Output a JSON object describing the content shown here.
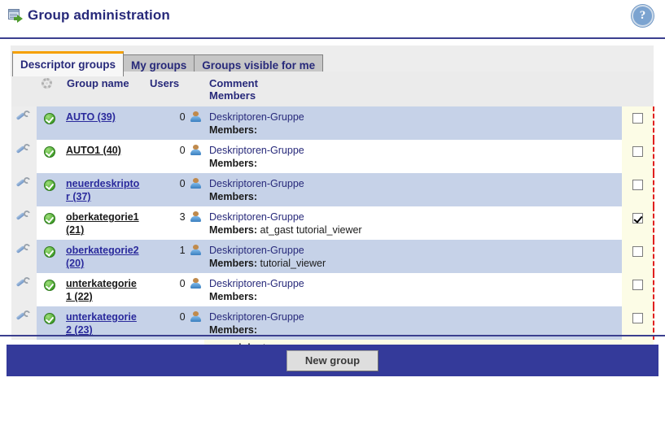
{
  "header": {
    "title": "Group administration",
    "title_icon": "window-export-icon",
    "help_icon": "help-question-icon",
    "help_glyph": "?"
  },
  "tabs": [
    {
      "label": "Descriptor groups",
      "active": true
    },
    {
      "label": "My groups",
      "active": false
    },
    {
      "label": "Groups visible for me",
      "active": false
    }
  ],
  "table": {
    "columns": {
      "wrench": "",
      "status": "",
      "status_icon": "gear-icon",
      "group_name": "Group name",
      "users": "Users",
      "comment": "Comment",
      "members": "Members",
      "check": ""
    },
    "rows": [
      {
        "wrench_icon": "wrench-icon",
        "status_icon": "green-check-icon",
        "name": "AUTO (39)",
        "users": "0",
        "user_icon": "user-icon",
        "comment": "Deskriptoren-Gruppe",
        "members_label": "Members:",
        "members_value": "",
        "checked": false,
        "shaded": true,
        "link_style": "link"
      },
      {
        "wrench_icon": "wrench-icon",
        "status_icon": "green-check-icon",
        "name": "AUTO1 (40)",
        "users": "0",
        "user_icon": "user-icon",
        "comment": "Deskriptoren-Gruppe",
        "members_label": "Members:",
        "members_value": "",
        "checked": false,
        "shaded": false,
        "link_style": "plain"
      },
      {
        "wrench_icon": "wrench-icon",
        "status_icon": "green-check-icon",
        "name": "neuerdeskriptor (37)",
        "users": "0",
        "user_icon": "user-icon",
        "comment": "Deskriptoren-Gruppe",
        "members_label": "Members:",
        "members_value": "",
        "checked": false,
        "shaded": true,
        "link_style": "link"
      },
      {
        "wrench_icon": "wrench-icon",
        "status_icon": "green-check-icon",
        "name": "oberkategorie1 (21)",
        "users": "3",
        "user_icon": "user-icon",
        "comment": "Deskriptoren-Gruppe",
        "members_label": "Members:",
        "members_value": "at_gast tutorial_viewer",
        "checked": true,
        "shaded": false,
        "link_style": "plain"
      },
      {
        "wrench_icon": "wrench-icon",
        "status_icon": "green-check-icon",
        "name": "oberkategorie2 (20)",
        "users": "1",
        "user_icon": "user-icon",
        "comment": "Deskriptoren-Gruppe",
        "members_label": "Members:",
        "members_value": "tutorial_viewer",
        "checked": false,
        "shaded": true,
        "link_style": "link"
      },
      {
        "wrench_icon": "wrench-icon",
        "status_icon": "green-check-icon",
        "name": "unterkategorie1 (22)",
        "users": "0",
        "user_icon": "user-icon",
        "comment": "Deskriptoren-Gruppe",
        "members_label": "Members:",
        "members_value": "",
        "checked": false,
        "shaded": false,
        "link_style": "plain"
      },
      {
        "wrench_icon": "wrench-icon",
        "status_icon": "green-check-icon",
        "name": "unterkategorie2 (23)",
        "users": "0",
        "user_icon": "user-icon",
        "comment": "Deskriptoren-Gruppe",
        "members_label": "Members:",
        "members_value": "",
        "checked": false,
        "shaded": true,
        "link_style": "link"
      }
    ],
    "recipient_note": "as recipient"
  },
  "footer": {
    "new_group_label": "New group"
  },
  "colors": {
    "accent_orange": "#f5a000",
    "navy": "#27297a",
    "footer_blue": "#343a9a",
    "row_shaded": "#c6d2e8",
    "highlight_yellow": "#fcfce6",
    "highlight_border": "#e02020"
  }
}
